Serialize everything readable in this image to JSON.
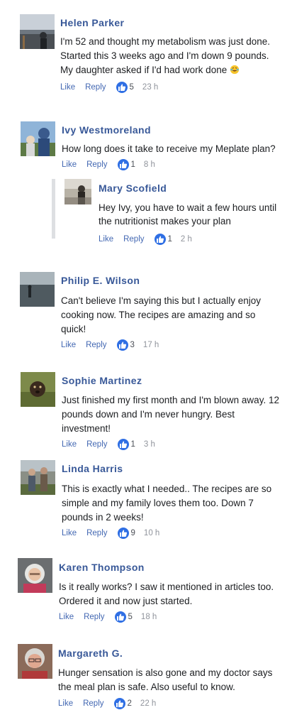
{
  "comments": [
    {
      "name": "Helen Parker",
      "text": "I'm 52 and thought my metabolism was just done. Started this 3 weeks ago and I'm down 9 pounds. My daughter asked if I'd had work done",
      "emoji": "laughing-tears-emoji",
      "like_label": "Like",
      "reply_label": "Reply",
      "likes": "5",
      "time": "23 h"
    },
    {
      "name": "Ivy Westmoreland",
      "text": "How long does it take to receive my Meplate plan?",
      "like_label": "Like",
      "reply_label": "Reply",
      "likes": "1",
      "time": "8 h"
    },
    {
      "name": "Mary Scofield",
      "text": "Hey Ivy, you have to wait a few hours until the nutritionist makes your plan",
      "like_label": "Like",
      "reply_label": "Reply",
      "likes": "1",
      "time": "2 h"
    },
    {
      "name": "Philip E. Wilson",
      "text": "Can't believe I'm saying this but I actually enjoy cooking now. The recipes are amazing and so quick!",
      "like_label": "Like",
      "reply_label": "Reply",
      "likes": "3",
      "time": "17 h"
    },
    {
      "name": "Sophie Martinez",
      "text": "Just finished my first month and I'm blown away. 12 pounds down and I'm never hungry. Best investment!",
      "like_label": "Like",
      "reply_label": "Reply",
      "likes": "1",
      "time": "3 h"
    },
    {
      "name": "Linda Harris",
      "text": "This is exactly what I needed.. The recipes are so simple and my family loves them too. Down 7 pounds in 2 weeks!",
      "like_label": "Like",
      "reply_label": "Reply",
      "likes": "9",
      "time": "10 h"
    },
    {
      "name": "Karen Thompson",
      "text": "Is it really works? I saw it mentioned in articles too. Ordered it and now just started.",
      "like_label": "Like",
      "reply_label": "Reply",
      "likes": "5",
      "time": "18 h"
    },
    {
      "name": "Margareth G.",
      "text": "Hunger sensation is also gone and my doctor says the meal plan is safe. Also useful to know.",
      "like_label": "Like",
      "reply_label": "Reply",
      "likes": "2",
      "time": "22 h"
    }
  ],
  "colors": {
    "name": "#385898",
    "link": "#4267b2",
    "like_badge": "#2f6fe4",
    "time": "#90949c"
  }
}
